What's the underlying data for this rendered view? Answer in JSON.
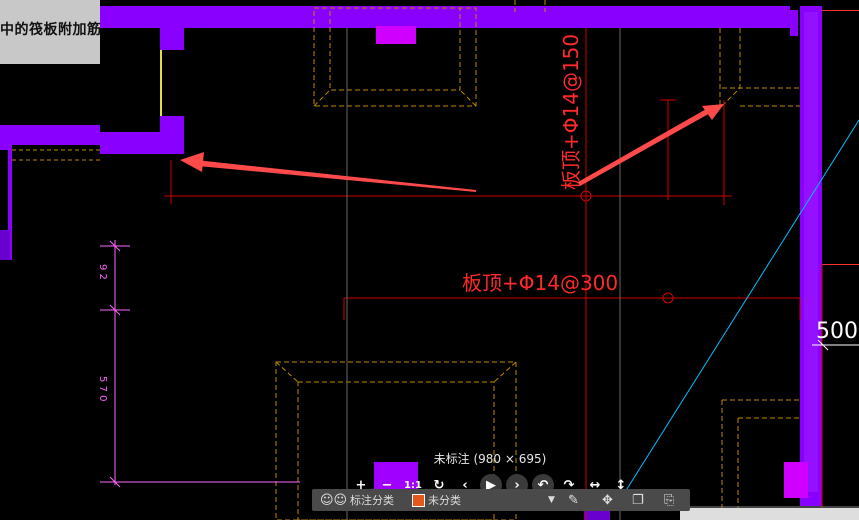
{
  "window": {
    "title_tab": "中的筏板附加筋"
  },
  "drawing": {
    "annotations": [
      {
        "id": "rebar-top",
        "text": "板顶+Φ14@150"
      },
      {
        "id": "rebar-mid",
        "text": "板顶+Φ14@300"
      },
      {
        "id": "dim-right",
        "text": "500"
      }
    ],
    "colors": {
      "wall": "#8a00ff",
      "axis": "#d00000",
      "dim": "#ff66ff",
      "dashed": "#c08a00",
      "diag": "#00c0ff",
      "arrow": "#ff4a4a"
    }
  },
  "viewer": {
    "status_text": "未标注 (980 × 695)",
    "toolbar": {
      "zoom_in": "+",
      "zoom_out": "−",
      "actual_size": "1:1",
      "refresh": "↻",
      "prev": "‹",
      "play": "▶",
      "next": "›",
      "undo": "↶",
      "redo": "↷",
      "fit_width": "↔",
      "fit_height": "↕"
    },
    "sub_toolbar": {
      "category_label": "标注分类",
      "selected_category": "未分类",
      "category_color": "#e4571d"
    }
  }
}
